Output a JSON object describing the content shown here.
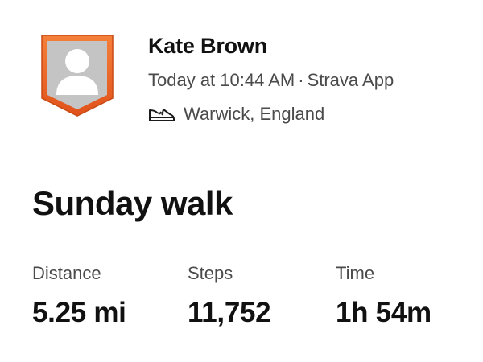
{
  "athlete": {
    "name": "Kate Brown",
    "timestamp": "Today at 10:44 AM",
    "separator": "·",
    "source": "Strava App",
    "location": "Warwick, England",
    "activity_icon": "shoe-icon",
    "avatar_icon": "person-placeholder-icon",
    "avatar_frame_color": "#f26a1f"
  },
  "activity": {
    "title": "Sunday walk"
  },
  "stats": [
    {
      "label": "Distance",
      "value": "5.25 mi"
    },
    {
      "label": "Steps",
      "value": "11,752"
    },
    {
      "label": "Time",
      "value": "1h 54m"
    }
  ]
}
